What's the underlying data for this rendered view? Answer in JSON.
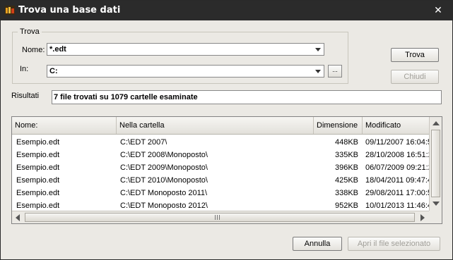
{
  "window": {
    "title": "Trova una base dati",
    "close_glyph": "✕"
  },
  "search": {
    "group_label": "Trova",
    "name_label": "Nome:",
    "name_value": "*.edt",
    "in_label": "In:",
    "in_value": "C:",
    "browse_label": "..."
  },
  "buttons": {
    "find": "Trova",
    "close": "Chiudi",
    "cancel": "Annulla",
    "open": "Apri il file selezionato"
  },
  "results": {
    "label": "Risultati",
    "summary": "7 file trovati su 1079 cartelle esaminate"
  },
  "table": {
    "columns": [
      "Nome:",
      "Nella cartella",
      "Dimensione",
      "Modificato"
    ],
    "rows": [
      {
        "name": "Esempio.edt",
        "folder": "C:\\EDT 2007\\",
        "size": "448KB",
        "modified": "09/11/2007 16:04:5"
      },
      {
        "name": "Esempio.edt",
        "folder": "C:\\EDT 2008\\Monoposto\\",
        "size": "335KB",
        "modified": "28/10/2008 16:51:2"
      },
      {
        "name": "Esempio.edt",
        "folder": "C:\\EDT 2009\\Monoposto\\",
        "size": "396KB",
        "modified": "06/07/2009 09:21:2"
      },
      {
        "name": "Esempio.edt",
        "folder": "C:\\EDT 2010\\Monoposto\\",
        "size": "425KB",
        "modified": "18/04/2011 09:47:4"
      },
      {
        "name": "Esempio.edt",
        "folder": "C:\\EDT Monoposto 2011\\",
        "size": "338KB",
        "modified": "29/08/2011 17:00:5"
      },
      {
        "name": "Esempio.edt",
        "folder": "C:\\EDT Monoposto 2012\\",
        "size": "952KB",
        "modified": "10/01/2013 11:46:4"
      }
    ]
  },
  "icons": {
    "app": "edt-logo-icon",
    "close": "close-icon",
    "scroll_grip": "grip-icon"
  },
  "colors": {
    "titlebar": "#2b2b2b",
    "dialog_bg": "#ebe9e4"
  }
}
